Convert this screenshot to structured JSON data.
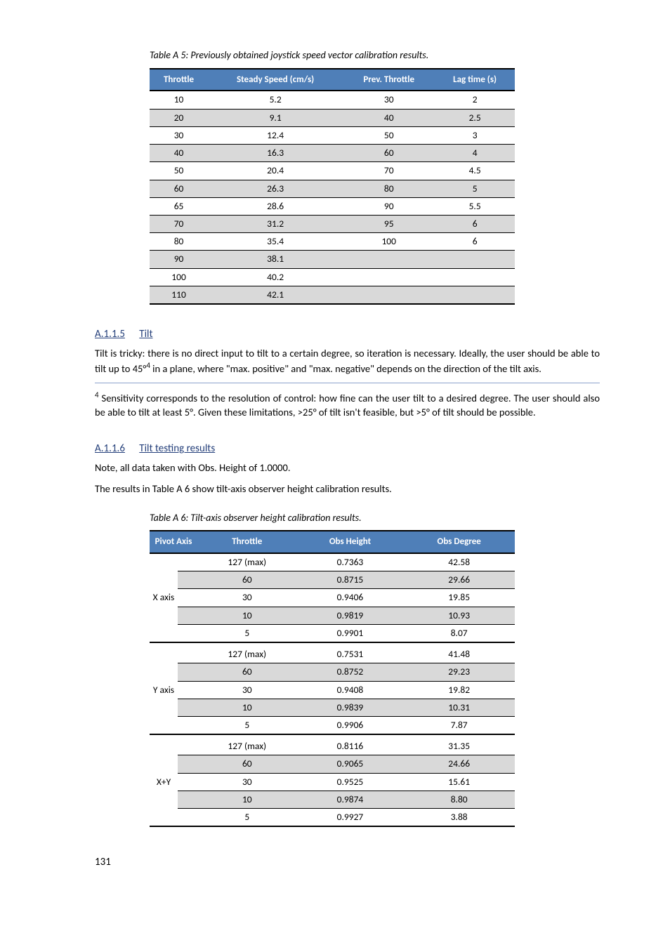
{
  "table1": {
    "title": "Table A 5: Previously obtained joystick speed vector calibration results.",
    "headers": [
      "Throttle",
      "Steady Speed (cm/s)",
      "Prev. Throttle",
      "Lag time (s)"
    ],
    "rows": [
      {
        "t": "10",
        "v": "5.2",
        "p": "30",
        "lag": "2"
      },
      {
        "t": "20",
        "v": "9.1",
        "p": "40",
        "lag": "2.5"
      },
      {
        "t": "30",
        "v": "12.4",
        "p": "50",
        "lag": "3"
      },
      {
        "t": "40",
        "v": "16.3",
        "p": "60",
        "lag": "4"
      },
      {
        "t": "50",
        "v": "20.4",
        "p": "70",
        "lag": "4.5"
      },
      {
        "t": "60",
        "v": "26.3",
        "p": "80",
        "lag": "5"
      },
      {
        "t": "65",
        "v": "28.6",
        "p": "90",
        "lag": "5.5"
      },
      {
        "t": "70",
        "v": "31.2",
        "p": "95",
        "lag": "6"
      },
      {
        "t": "80",
        "v": "35.4",
        "p": "100",
        "lag": "6"
      },
      {
        "t": "90",
        "v": "38.1",
        "p": "",
        "lag": ""
      },
      {
        "t": "100",
        "v": "40.2",
        "p": "",
        "lag": ""
      },
      {
        "t": "110",
        "v": "42.1",
        "p": "",
        "lag": ""
      }
    ]
  },
  "section1": {
    "heading_num": "A.1.1.5",
    "heading_label": "Tilt",
    "p1_a": "Tilt is tricky: there is no direct input to tilt to a certain degree, so iteration is necessary. Ideally, the user should be able to tilt up to 45",
    "p1_b": " in a plane, where \"max. positive\" and \"max. negative\" depends on the direction of the tilt axis.",
    "footnote_num": "4",
    "footnote_text": " Sensitivity corresponds to the resolution of control: how fine can the user tilt to a desired degree. The user should also be able to tilt at least 5°. Given these limitations, >25° of tilt isn't feasible, but >5° of tilt should be possible."
  },
  "section2": {
    "heading_num": "A.1.1.6",
    "heading_label": "Tilt testing results",
    "p1": "Note, all data taken with Obs. Height of 1.0000.",
    "p2": "The results in Table A 6 show tilt-axis observer height calibration results."
  },
  "table2": {
    "title": "Table A 6: Tilt-axis observer height calibration results.",
    "headers": [
      "Pivot Axis",
      "Throttle",
      "Obs Height",
      "Obs Degree"
    ],
    "groups": [
      {
        "axis": "X axis",
        "rows": [
          {
            "t": "127 (max)",
            "h": "0.7363",
            "d": "42.58"
          },
          {
            "t": "60",
            "h": "0.8715",
            "d": "29.66"
          },
          {
            "t": "30",
            "h": "0.9406",
            "d": "19.85"
          },
          {
            "t": "10",
            "h": "0.9819",
            "d": "10.93"
          },
          {
            "t": "5",
            "h": "0.9901",
            "d": "8.07"
          }
        ]
      },
      {
        "axis": "Y axis",
        "rows": [
          {
            "t": "127 (max)",
            "h": "0.7531",
            "d": "41.48"
          },
          {
            "t": "60",
            "h": "0.8752",
            "d": "29.23"
          },
          {
            "t": "30",
            "h": "0.9408",
            "d": "19.82"
          },
          {
            "t": "10",
            "h": "0.9839",
            "d": "10.31"
          },
          {
            "t": "5",
            "h": "0.9906",
            "d": "7.87"
          }
        ]
      },
      {
        "axis": "X+Y",
        "rows": [
          {
            "t": "127 (max)",
            "h": "0.8116",
            "d": "31.35"
          },
          {
            "t": "60",
            "h": "0.9065",
            "d": "24.66"
          },
          {
            "t": "30",
            "h": "0.9525",
            "d": "15.61"
          },
          {
            "t": "10",
            "h": "0.9874",
            "d": "8.80"
          },
          {
            "t": "5",
            "h": "0.9927",
            "d": "3.88"
          }
        ]
      }
    ]
  },
  "footer": {
    "left": "131"
  }
}
